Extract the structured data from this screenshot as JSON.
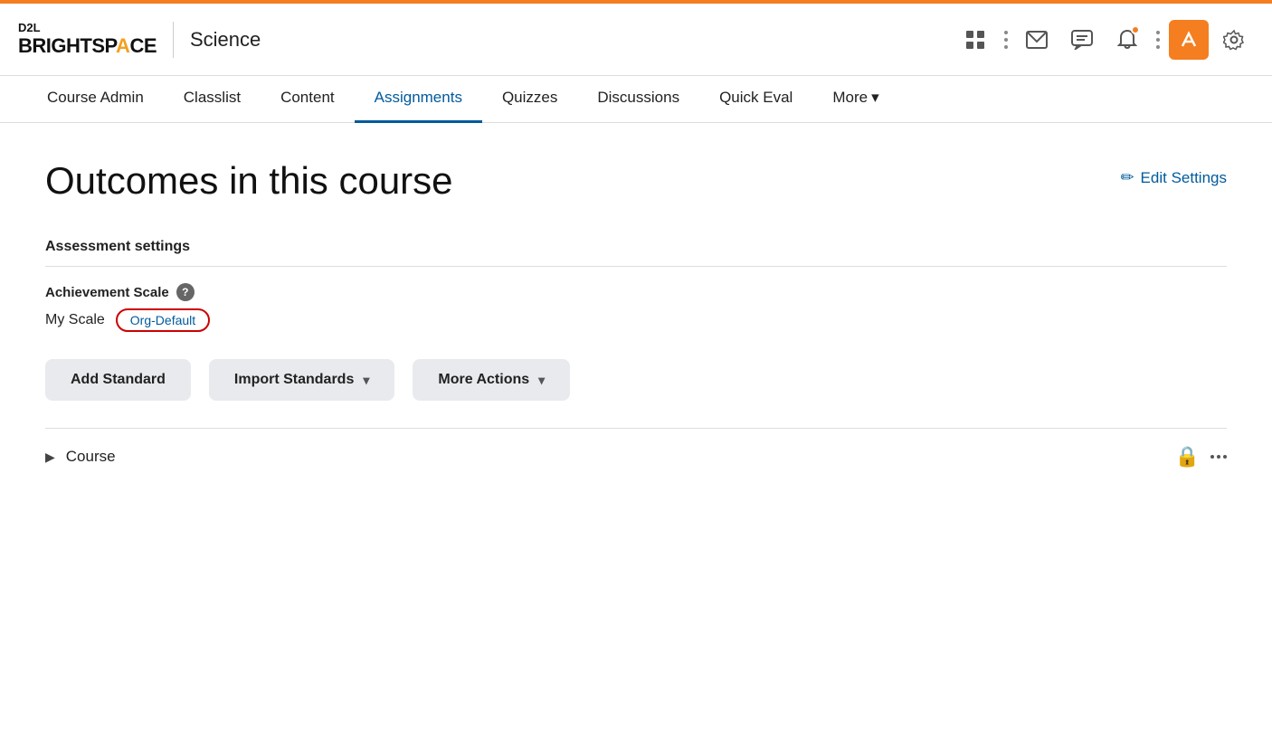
{
  "topbar": {
    "logo_d2l": "D2L",
    "logo_bright": "BRIGHTSP",
    "logo_ace": "A",
    "logo_ce": "CE",
    "course_title": "Science"
  },
  "nav": {
    "items": [
      {
        "label": "Course Admin",
        "active": false
      },
      {
        "label": "Classlist",
        "active": false
      },
      {
        "label": "Content",
        "active": false
      },
      {
        "label": "Assignments",
        "active": true
      },
      {
        "label": "Quizzes",
        "active": false
      },
      {
        "label": "Discussions",
        "active": false
      },
      {
        "label": "Quick Eval",
        "active": false
      },
      {
        "label": "More",
        "active": false,
        "has_chevron": true
      }
    ]
  },
  "page": {
    "title": "Outcomes in this course",
    "edit_settings_label": "Edit Settings"
  },
  "assessment": {
    "section_title": "Assessment settings",
    "achievement_scale_label": "Achievement Scale",
    "my_scale_label": "My Scale",
    "org_default_badge": "Org-Default"
  },
  "buttons": {
    "add_standard": "Add Standard",
    "import_standards": "Import Standards",
    "more_actions": "More Actions"
  },
  "course_row": {
    "label": "Course"
  },
  "icons": {
    "help": "?",
    "pencil": "✏",
    "chevron_down": "▾",
    "expand_right": "▶",
    "lock": "🔒"
  }
}
